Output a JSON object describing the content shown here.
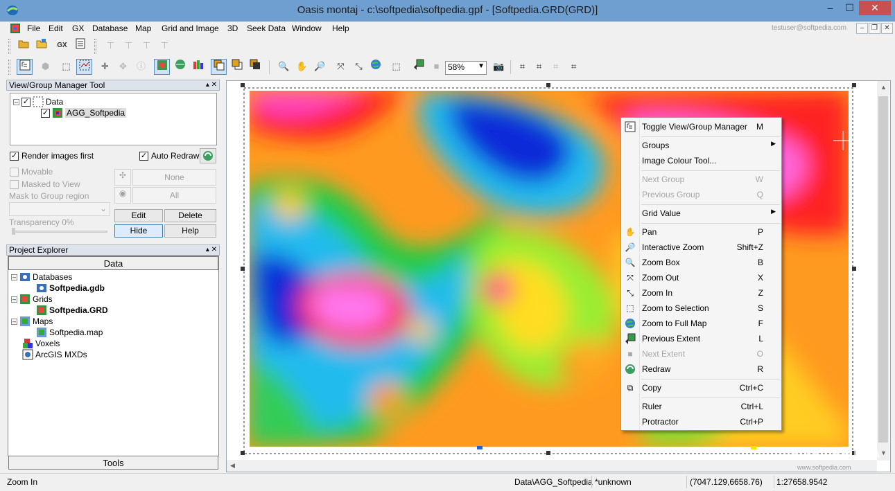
{
  "window": {
    "title": "Oasis montaj - c:\\softpedia\\softpedia.gpf - [Softpedia.GRD(GRD)]",
    "controls": {
      "minimize": "–",
      "maximize": "☐",
      "close": "✕"
    }
  },
  "menubar": {
    "items": [
      "File",
      "Edit",
      "GX",
      "Database",
      "Map",
      "Grid and Image",
      "3D",
      "Seek Data",
      "Window",
      "Help"
    ],
    "user": "testuser@softpedia.com",
    "mdi": {
      "minimize": "–",
      "restore": "❐",
      "close": "✕"
    }
  },
  "toolbar": {
    "gx_label": "GX",
    "zoom_value": "58%"
  },
  "view_group_tool": {
    "title": "View/Group Manager Tool",
    "tree": {
      "root": "Data",
      "child": "AGG_Softpedia"
    },
    "render_images_first": "Render images first",
    "auto_redraw": "Auto Redraw",
    "movable": "Movable",
    "masked_to_view": "Masked to View",
    "mask_region": "Mask to Group region",
    "transparency": "Transparency 0%",
    "none_btn": "None",
    "all_btn": "All",
    "edit_btn": "Edit",
    "delete_btn": "Delete",
    "hide_btn": "Hide",
    "help_btn": "Help"
  },
  "project_explorer": {
    "title": "Project Explorer",
    "data_tab": "Data",
    "tools_tab": "Tools",
    "nodes": {
      "databases": "Databases",
      "gdb": "Softpedia.gdb",
      "grids": "Grids",
      "grd": "Softpedia.GRD",
      "maps": "Maps",
      "map": "Softpedia.map",
      "voxels": "Voxels",
      "arcgis": "ArcGIS MXDs"
    }
  },
  "context_menu": {
    "items": [
      {
        "label": "Toggle View/Group Manager",
        "key": "M",
        "icon": "toggle-manager-icon"
      },
      {
        "label": "Groups",
        "key": "",
        "icon": ""
      },
      {
        "label": "Image Colour Tool...",
        "key": "",
        "icon": ""
      },
      {
        "label": "Next Group",
        "key": "W",
        "icon": ""
      },
      {
        "label": "Previous Group",
        "key": "Q",
        "icon": ""
      },
      {
        "label": "Grid Value",
        "key": "",
        "icon": ""
      },
      {
        "label": "Pan",
        "key": "P",
        "icon": "pan-hand-icon"
      },
      {
        "label": "Interactive Zoom",
        "key": "Shift+Z",
        "icon": "interactive-zoom-icon"
      },
      {
        "label": "Zoom Box",
        "key": "B",
        "icon": "zoom-box-icon"
      },
      {
        "label": "Zoom Out",
        "key": "X",
        "icon": "zoom-out-icon"
      },
      {
        "label": "Zoom In",
        "key": "Z",
        "icon": "zoom-in-icon"
      },
      {
        "label": "Zoom to Selection",
        "key": "S",
        "icon": "zoom-selection-icon"
      },
      {
        "label": "Zoom to Full Map",
        "key": "F",
        "icon": "globe-icon"
      },
      {
        "label": "Previous Extent",
        "key": "L",
        "icon": "previous-extent-icon"
      },
      {
        "label": "Next Extent",
        "key": "O",
        "icon": "next-extent-icon"
      },
      {
        "label": "Redraw",
        "key": "R",
        "icon": "redraw-icon"
      },
      {
        "label": "Copy",
        "key": "Ctrl+C",
        "icon": "copy-icon"
      },
      {
        "label": "Ruler",
        "key": "Ctrl+L",
        "icon": ""
      },
      {
        "label": "Protractor",
        "key": "Ctrl+P",
        "icon": ""
      }
    ]
  },
  "statusbar": {
    "message": "Zoom In",
    "group": "Data\\AGG_Softpedia",
    "value": "*unknown",
    "coords": "(7047.129,6658.76)",
    "scale": "1:27658.9542"
  },
  "watermark": {
    "text": "SOFTPEDIA",
    "url": "www.softpedia.com"
  }
}
